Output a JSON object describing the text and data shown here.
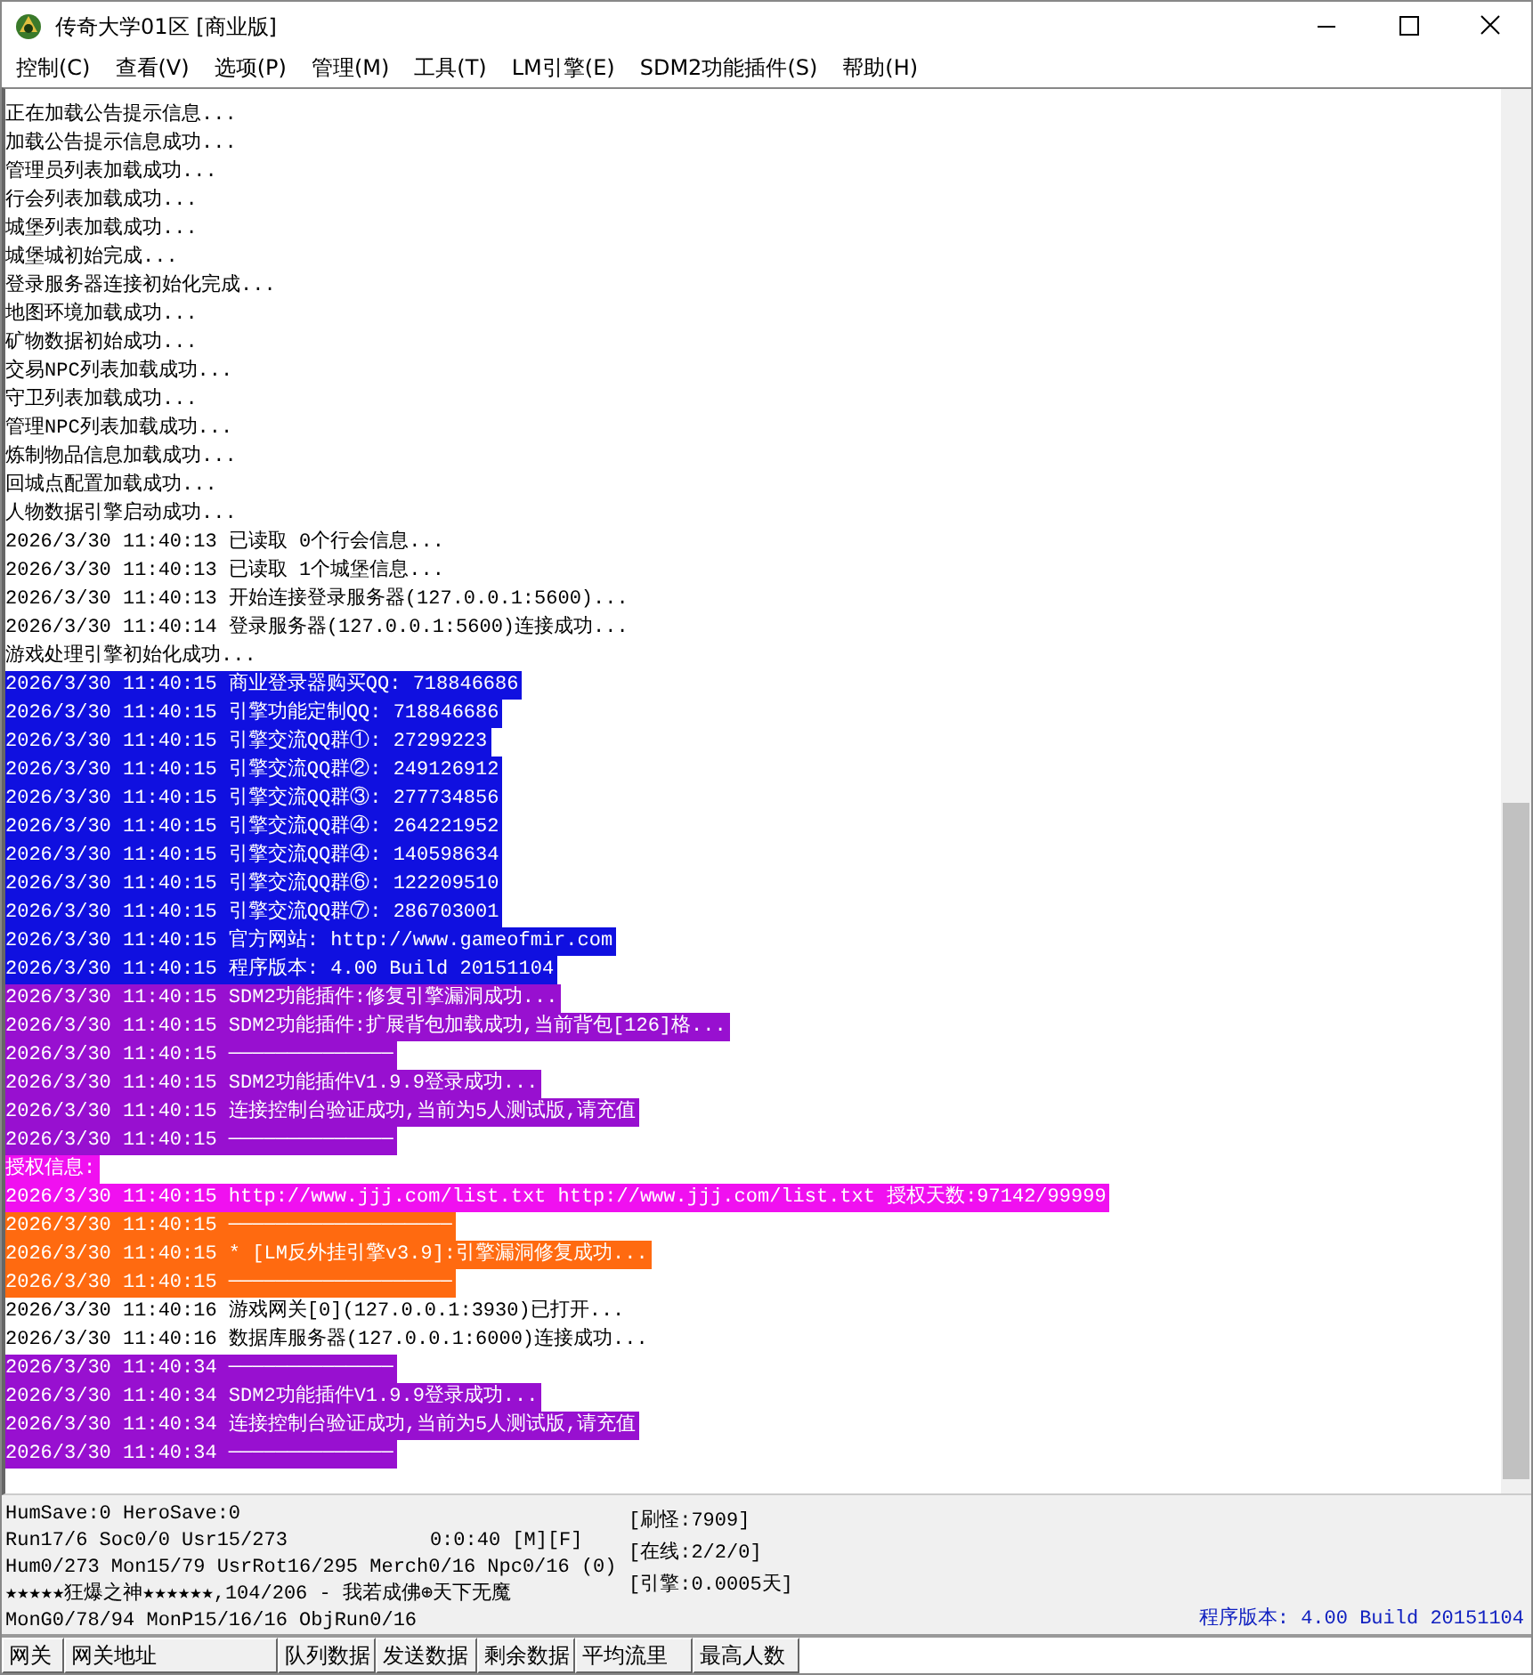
{
  "window": {
    "title": "传奇大学01区 [商业版]"
  },
  "menu": [
    "控制(C)",
    "查看(V)",
    "选项(P)",
    "管理(M)",
    "工具(T)",
    "LM引擎(E)",
    "SDM2功能插件(S)",
    "帮助(H)"
  ],
  "log": [
    {
      "text": "正在加载公告提示信息...",
      "color": "#ffffff"
    },
    {
      "text": "加载公告提示信息成功...",
      "color": "#ffffff"
    },
    {
      "text": "管理员列表加载成功...",
      "color": "#ffffff"
    },
    {
      "text": "行会列表加载成功...",
      "color": "#ffffff"
    },
    {
      "text": "城堡列表加载成功...",
      "color": "#ffffff"
    },
    {
      "text": "城堡城初始完成...",
      "color": "#ffffff"
    },
    {
      "text": "登录服务器连接初始化完成...",
      "color": "#ffffff"
    },
    {
      "text": "地图环境加载成功...",
      "color": "#ffffff"
    },
    {
      "text": "矿物数据初始成功...",
      "color": "#ffffff"
    },
    {
      "text": "交易NPC列表加载成功...",
      "color": "#ffffff"
    },
    {
      "text": "守卫列表加载成功...",
      "color": "#ffffff"
    },
    {
      "text": "管理NPC列表加载成功...",
      "color": "#ffffff"
    },
    {
      "text": "炼制物品信息加载成功...",
      "color": "#ffffff"
    },
    {
      "text": "回城点配置加载成功...",
      "color": "#ffffff"
    },
    {
      "text": "人物数据引擎启动成功...",
      "color": "#ffffff"
    },
    {
      "text": "2026/3/30 11:40:13 已读取 0个行会信息...",
      "color": "#ffffff"
    },
    {
      "text": "2026/3/30 11:40:13 已读取 1个城堡信息...",
      "color": "#ffffff"
    },
    {
      "text": "2026/3/30 11:40:13 开始连接登录服务器(127.0.0.1:5600)...",
      "color": "#ffffff"
    },
    {
      "text": "2026/3/30 11:40:14 登录服务器(127.0.0.1:5600)连接成功...",
      "color": "#ffffff"
    },
    {
      "text": "游戏处理引擎初始化成功...",
      "color": "#ffffff"
    },
    {
      "text": "2026/3/30 11:40:15 商业登录器购买QQ: 718846686",
      "color": "#1010e0"
    },
    {
      "text": "2026/3/30 11:40:15 引擎功能定制QQ: 718846686",
      "color": "#1010e0"
    },
    {
      "text": "2026/3/30 11:40:15 引擎交流QQ群①: 27299223",
      "color": "#1010e0"
    },
    {
      "text": "2026/3/30 11:40:15 引擎交流QQ群②: 249126912",
      "color": "#1010e0"
    },
    {
      "text": "2026/3/30 11:40:15 引擎交流QQ群③: 277734856",
      "color": "#1010e0"
    },
    {
      "text": "2026/3/30 11:40:15 引擎交流QQ群④: 264221952",
      "color": "#1010e0"
    },
    {
      "text": "2026/3/30 11:40:15 引擎交流QQ群④: 140598634",
      "color": "#1010e0"
    },
    {
      "text": "2026/3/30 11:40:15 引擎交流QQ群⑥: 122209510",
      "color": "#1010e0"
    },
    {
      "text": "2026/3/30 11:40:15 引擎交流QQ群⑦: 286703001",
      "color": "#1010e0"
    },
    {
      "text": "2026/3/30 11:40:15 官方网站: http://www.gameofmir.com",
      "color": "#1010e0"
    },
    {
      "text": "2026/3/30 11:40:15 程序版本: 4.00 Build 20151104",
      "color": "#1010e0"
    },
    {
      "text": "2026/3/30 11:40:15 SDM2功能插件:修复引擎漏洞成功...",
      "color": "#9810d0"
    },
    {
      "text": "2026/3/30 11:40:15 SDM2功能插件:扩展背包加载成功,当前背包[126]格...",
      "color": "#9810d0"
    },
    {
      "text": "2026/3/30 11:40:15 ──────────────",
      "color": "#9810d0"
    },
    {
      "text": "2026/3/30 11:40:15 SDM2功能插件V1.9.9登录成功...",
      "color": "#9810d0"
    },
    {
      "text": "2026/3/30 11:40:15 连接控制台验证成功,当前为5人测试版,请充值",
      "color": "#9810d0"
    },
    {
      "text": "2026/3/30 11:40:15 ──────────────",
      "color": "#9810d0"
    },
    {
      "text": "授权信息:",
      "color": "#f010f0"
    },
    {
      "text": "2026/3/30 11:40:15 http://www.jjj.com/list.txt http://www.jjj.com/list.txt 授权天数:97142/99999",
      "color": "#f010f0"
    },
    {
      "text": "2026/3/30 11:40:15 ───────────────────",
      "color": "#ff6a10"
    },
    {
      "text": "2026/3/30 11:40:15 * [LM反外挂引擎v3.9]:引擎漏洞修复成功...",
      "color": "#ff6a10"
    },
    {
      "text": "2026/3/30 11:40:15 ───────────────────",
      "color": "#ff6a10"
    },
    {
      "text": "2026/3/30 11:40:16 游戏网关[0](127.0.0.1:3930)已打开...",
      "color": "#ffffff"
    },
    {
      "text": "2026/3/30 11:40:16 数据库服务器(127.0.0.1:6000)连接成功...",
      "color": "#ffffff"
    },
    {
      "text": "2026/3/30 11:40:34 ──────────────",
      "color": "#9810d0"
    },
    {
      "text": "2026/3/30 11:40:34 SDM2功能插件V1.9.9登录成功...",
      "color": "#9810d0"
    },
    {
      "text": "2026/3/30 11:40:34 连接控制台验证成功,当前为5人测试版,请充值",
      "color": "#9810d0"
    },
    {
      "text": "2026/3/30 11:40:34 ──────────────",
      "color": "#9810d0"
    }
  ],
  "status": {
    "lines": [
      "HumSave:0 HeroSave:0",
      "Run17/6 Soc0/0 Usr15/273",
      "Hum0/273 Mon15/79 UsrRot16/295 Merch0/16 Npc0/16 (0)",
      "★★★★★狂爆之神★★★★★★,104/206 - 我若成佛⊕天下无魔",
      "MonG0/78/94 MonP15/16/16 ObjRun0/16"
    ],
    "timer": "0:0:40 [M][F]",
    "counters": [
      "[刷怪:7909]",
      "[在线:2/2/0]",
      "[引擎:0.0005天]"
    ],
    "version": "程序版本: 4.00 Build 20151104"
  },
  "gateway_table": {
    "columns": [
      "网关",
      "网关地址",
      "队列数据",
      "发送数据",
      "剩余数据",
      "平均流里",
      "最高人数"
    ]
  }
}
